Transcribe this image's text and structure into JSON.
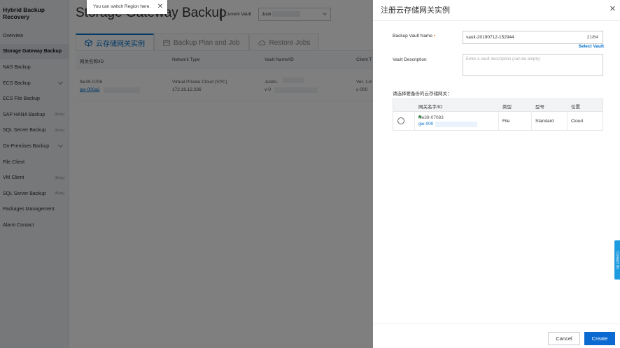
{
  "sidebar": {
    "brand": "Hybrid Backup Recovery",
    "items": [
      {
        "label": "Overview",
        "beta": "",
        "expandable": false,
        "active": false
      },
      {
        "label": "Storage Gateway Backup",
        "beta": "",
        "expandable": false,
        "active": true
      },
      {
        "label": "NAS Backup",
        "beta": "",
        "expandable": false,
        "active": false
      },
      {
        "label": "ECS Backup",
        "beta": "",
        "expandable": true,
        "active": false
      },
      {
        "label": "ECS File Backup",
        "beta": "",
        "expandable": false,
        "active": false
      },
      {
        "label": "SAP HANA Backup",
        "beta": "(Beta)",
        "expandable": false,
        "active": false
      },
      {
        "label": "SQL Server Backup",
        "beta": "(Beta)",
        "expandable": false,
        "active": false
      },
      {
        "label": "On-Premises Backup",
        "beta": "",
        "expandable": true,
        "active": false
      },
      {
        "label": "File Client",
        "beta": "",
        "expandable": false,
        "active": false
      },
      {
        "label": "VM Client",
        "beta": "(Beta)",
        "expandable": false,
        "active": false
      },
      {
        "label": "SQL Server Backup",
        "beta": "(Beta)",
        "expandable": false,
        "active": false
      },
      {
        "label": "Packages Management",
        "beta": "",
        "expandable": false,
        "active": false
      },
      {
        "label": "Alarm Contact",
        "beta": "",
        "expandable": false,
        "active": false
      }
    ]
  },
  "header": {
    "title": "Storage Gateway Backup",
    "vault_label": "Current Vault",
    "vault_value": "Justi"
  },
  "tooltip": {
    "text": "You can switch Region here."
  },
  "tabs": [
    {
      "label": "云存储网关实例",
      "icon": "gateway-icon",
      "active": true
    },
    {
      "label": "Backup Plan and Job",
      "icon": "calendar-icon",
      "active": false
    },
    {
      "label": "Restore Jobs",
      "icon": "cloud-icon",
      "active": false
    }
  ],
  "table": {
    "columns": [
      "网关名称/ID",
      "Network Type",
      "Vault Name/ID",
      "Client T"
    ],
    "rows": [
      {
        "name": "file39-0708",
        "id": "gw-000a2",
        "network": "Virtual Private Cloud (VPC)",
        "ip": "172.16.12.236",
        "vault": "Justin-",
        "vault_id": "v-0",
        "client_ver": "Ver. 1.8",
        "client_id": "c-000"
      }
    ]
  },
  "drawer": {
    "title": "注册云存储网关实例",
    "vault_name_label": "Backup Vault Name",
    "vault_name_value": "vault-20190712-152944",
    "vault_name_counter": "21/64",
    "select_vault": "Select Vault",
    "description_label": "Vault Description",
    "description_placeholder": "Enter a vault description (can be empty)",
    "gateway_prompt": "请选择要备份的云存储网关：",
    "gateway_columns": [
      "网关名字/ID",
      "类型",
      "型号",
      "位置"
    ],
    "gateway_rows": [
      {
        "name": "file39-07083",
        "id": "gw-000",
        "type": "File",
        "model": "Standard",
        "location": "Cloud",
        "status_color": "#2db04a"
      }
    ],
    "cancel_label": "Cancel",
    "create_label": "Create"
  },
  "contact_tab": {
    "label": "Contact Us"
  },
  "colors": {
    "primary": "#0b6ad1",
    "link": "#0070cc",
    "online": "#2db04a",
    "required": "#e56b0a"
  }
}
